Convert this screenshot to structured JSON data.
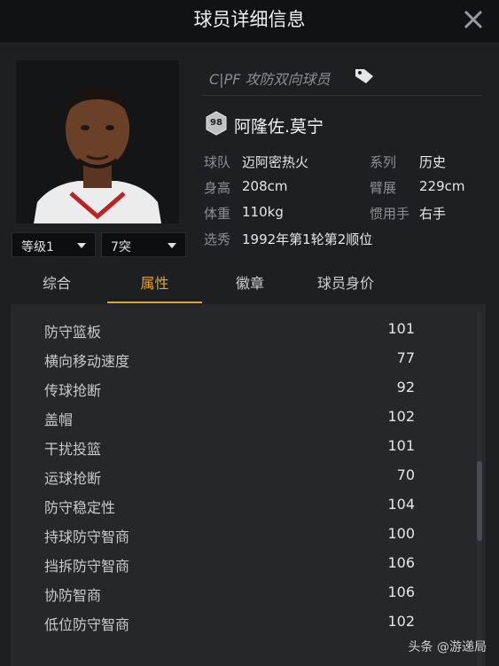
{
  "header": {
    "title": "球员详细信息",
    "close_icon": "close-icon"
  },
  "player": {
    "role": "C|PF 攻防双向球员",
    "rating": "98",
    "name": "阿隆佐.莫宁",
    "level_select": "等级1",
    "star_select": "7突",
    "info": [
      {
        "label": "球队",
        "value": "迈阿密热火"
      },
      {
        "label": "系列",
        "value": "历史"
      },
      {
        "label": "身高",
        "value": "208cm"
      },
      {
        "label": "臂展",
        "value": "229cm"
      },
      {
        "label": "体重",
        "value": "110kg"
      },
      {
        "label": "惯用手",
        "value": "右手"
      },
      {
        "label": "选秀",
        "value": "1992年第1轮第2顺位"
      }
    ]
  },
  "tabs": [
    {
      "label": "综合"
    },
    {
      "label": "属性"
    },
    {
      "label": "徽章"
    },
    {
      "label": "球员身价"
    }
  ],
  "active_tab": "属性",
  "attributes": [
    {
      "name": "防守篮板",
      "value": "101"
    },
    {
      "name": "横向移动速度",
      "value": "77"
    },
    {
      "name": "传球抢断",
      "value": "92"
    },
    {
      "name": "盖帽",
      "value": "102"
    },
    {
      "name": "干扰投篮",
      "value": "101"
    },
    {
      "name": "运球抢断",
      "value": "70"
    },
    {
      "name": "防守稳定性",
      "value": "104"
    },
    {
      "name": "持球防守智商",
      "value": "100"
    },
    {
      "name": "挡拆防守智商",
      "value": "106"
    },
    {
      "name": "协防智商",
      "value": "106"
    },
    {
      "name": "低位防守智商",
      "value": "102"
    }
  ],
  "watermark": "头条 @游递局",
  "colors": {
    "accent": "#e0a33a",
    "background": "#1e1f21",
    "panel": "#262729"
  }
}
